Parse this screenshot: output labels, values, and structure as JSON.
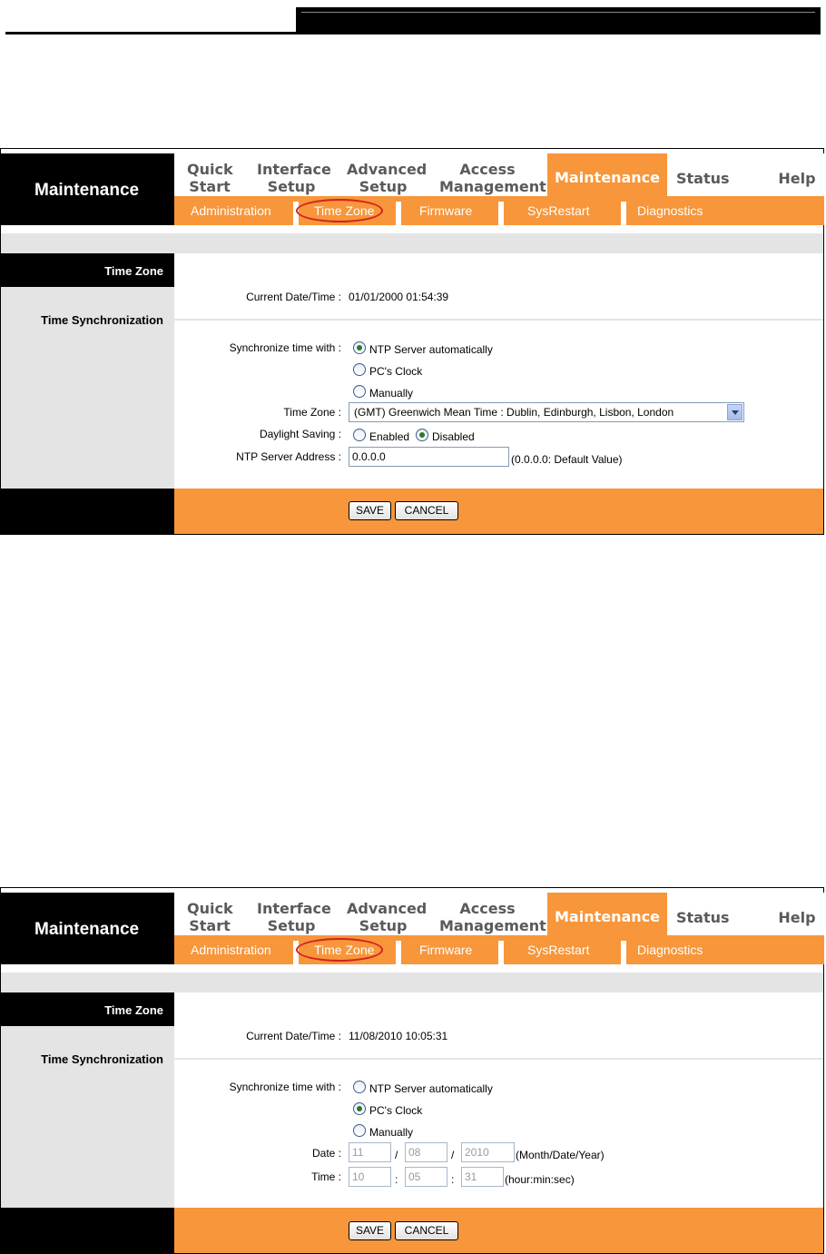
{
  "nav": {
    "logo": "Maintenance",
    "quick_start": [
      "Quick",
      "Start"
    ],
    "interface_setup": [
      "Interface",
      "Setup"
    ],
    "advanced_setup": [
      "Advanced",
      "Setup"
    ],
    "access_management": [
      "Access",
      "Management"
    ],
    "maintenance": "Maintenance",
    "status": "Status",
    "help": "Help"
  },
  "subnav": {
    "administration": "Administration",
    "time_zone": "Time Zone",
    "firmware": "Firmware",
    "sysrestart": "SysRestart",
    "diagnostics": "Diagnostics"
  },
  "section": {
    "title": "Time Zone",
    "subtitle": "Time Synchronization"
  },
  "labels": {
    "current_datetime": "Current Date/Time :",
    "sync_with": "Synchronize time with :",
    "time_zone": "Time Zone :",
    "daylight_saving": "Daylight Saving :",
    "ntp_server_address": "NTP Server Address :",
    "date": "Date :",
    "time": "Time :"
  },
  "options": {
    "ntp_auto": "NTP Server automatically",
    "pc_clock": "PC's Clock",
    "manually": "Manually",
    "enabled": "Enabled",
    "disabled": "Disabled"
  },
  "panel1": {
    "current_datetime": "01/01/2000 01:54:39",
    "sync_selected": "ntp_auto",
    "time_zone_value": "(GMT) Greenwich Mean Time : Dublin, Edinburgh, Lisbon, London",
    "daylight_selected": "disabled",
    "ntp_server_value": "0.0.0.0",
    "ntp_server_hint": "(0.0.0.0: Default Value)"
  },
  "panel2": {
    "current_datetime": "11/08/2010 10:05:31",
    "sync_selected": "pc_clock",
    "date_month": "11",
    "date_day": "08",
    "date_year": "2010",
    "date_sep": "/",
    "date_hint": "(Month/Date/Year)",
    "time_hour": "10",
    "time_min": "05",
    "time_sec": "31",
    "time_sep": ":",
    "time_hint": "(hour:min:sec)"
  },
  "buttons": {
    "save": "SAVE",
    "cancel": "CANCEL"
  },
  "colors": {
    "accent_orange": "#f7963a",
    "gray_band": "#e4e4e4",
    "highlight_circle": "#d42020"
  }
}
